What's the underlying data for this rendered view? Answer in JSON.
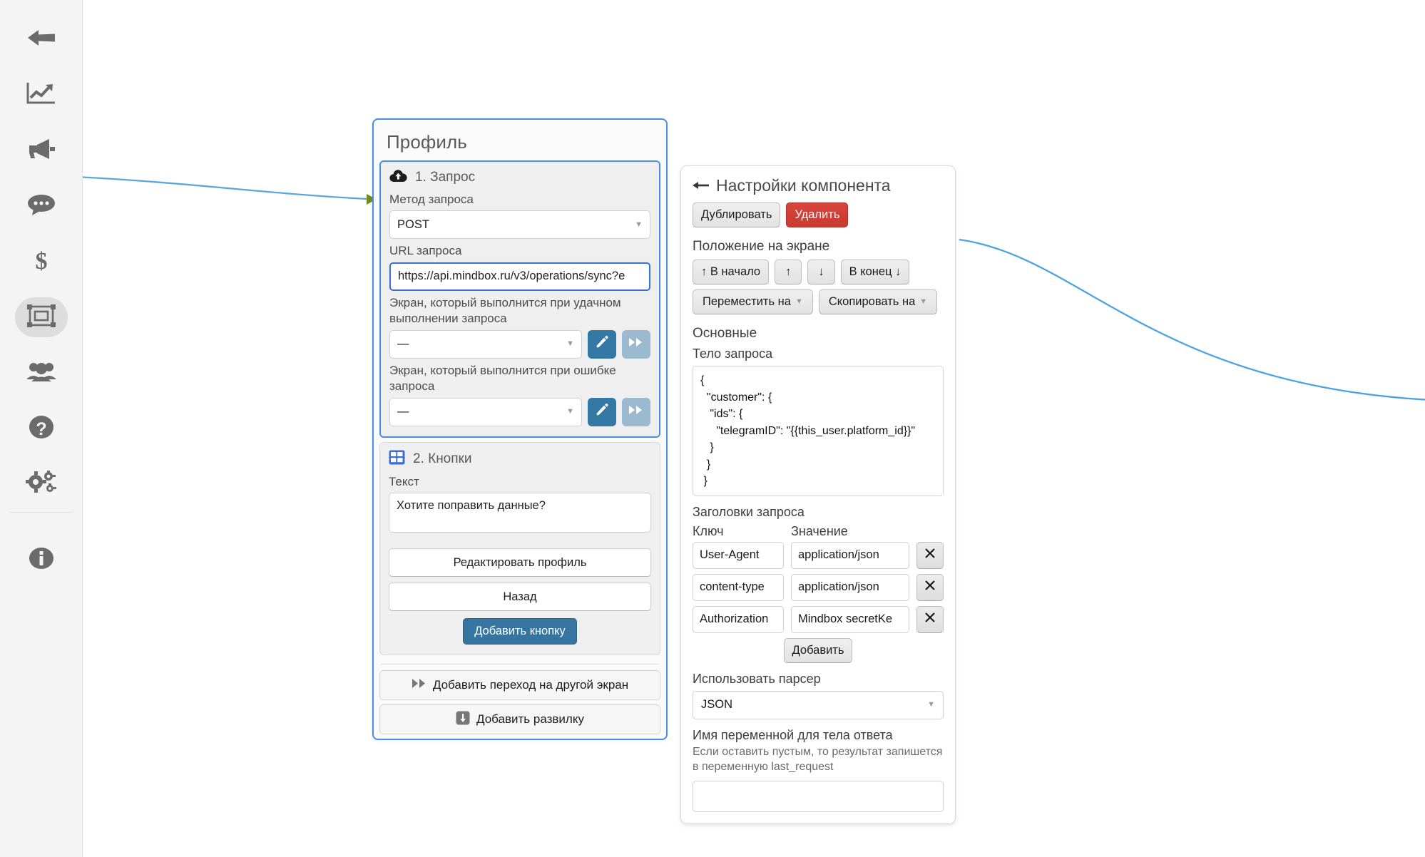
{
  "sidebar": {
    "items": [
      {
        "icon": "back-arrow-icon",
        "name": "back"
      },
      {
        "icon": "analytics-icon",
        "name": "analytics"
      },
      {
        "icon": "megaphone-icon",
        "name": "broadcast"
      },
      {
        "icon": "chat-bubble-icon",
        "name": "messages"
      },
      {
        "icon": "dollar-icon",
        "name": "billing"
      },
      {
        "icon": "screens-icon",
        "name": "screens",
        "active": true
      },
      {
        "icon": "users-icon",
        "name": "users"
      },
      {
        "icon": "question-icon",
        "name": "help"
      },
      {
        "icon": "gears-icon",
        "name": "settings"
      },
      {
        "icon": "info-icon",
        "name": "info"
      }
    ]
  },
  "screen_card": {
    "title": "Профиль",
    "blocks": [
      {
        "index_icon": "cloud-upload-icon",
        "title": "1. Запрос",
        "fields": {
          "method_label": "Метод запроса",
          "method_value": "POST",
          "url_label": "URL запроса",
          "url_value": "https://api.mindbox.ru/v3/operations/sync?e",
          "success_label": "Экран, который выполнится при удачном выполнении запроса",
          "success_value": "—",
          "error_label": "Экран, который выполнится при ошибке запроса",
          "error_value": "—"
        }
      },
      {
        "index_icon": "grid-icon",
        "title": "2. Кнопки",
        "fields": {
          "text_label": "Текст",
          "text_value": "Хотите поправить данные?"
        },
        "buttons": [
          "Редактировать профиль",
          "Назад"
        ],
        "add_button_label": "Добавить кнопку"
      }
    ],
    "footer_actions": [
      {
        "icon": "fast-forward-icon",
        "label": "Добавить переход на другой экран"
      },
      {
        "icon": "branch-icon",
        "label": "Добавить развилку"
      }
    ]
  },
  "settings_panel": {
    "title": "Настройки компонента",
    "back_icon": "back-arrow-icon",
    "duplicate_label": "Дублировать",
    "delete_label": "Удалить",
    "position_label": "Положение на экране",
    "position_buttons": [
      "↑ В начало",
      "↑",
      "↓",
      "В конец ↓"
    ],
    "move_to_label": "Переместить на",
    "copy_to_label": "Скопировать на",
    "basic_section": "Основные",
    "body_label": "Тело запроса",
    "body_value": "{\n  \"customer\": {\n   \"ids\": {\n     \"telegramID\": \"{{this_user.platform_id}}\"\n   }\n  }\n }",
    "headers_label": "Заголовки запроса",
    "headers_col_key": "Ключ",
    "headers_col_value": "Значение",
    "headers": [
      {
        "key": "User-Agent",
        "value": "application/json"
      },
      {
        "key": "content-type",
        "value": "application/json"
      },
      {
        "key": "Authorization",
        "value": "Mindbox secretKe"
      }
    ],
    "add_header_label": "Добавить",
    "parser_label": "Использовать парсер",
    "parser_value": "JSON",
    "response_var_label": "Имя переменной для тела ответа",
    "response_var_hint": "Если оставить пустым, то результат запишется в переменную last_request",
    "response_var_value": ""
  },
  "colors": {
    "accent_blue": "#4a90e2",
    "primary_btn": "#36759f",
    "muted_btn": "#9bb9cf",
    "danger": "#d9453c",
    "edge_line": "#5ba7d6",
    "arrow_head": "#6e8b1f"
  }
}
